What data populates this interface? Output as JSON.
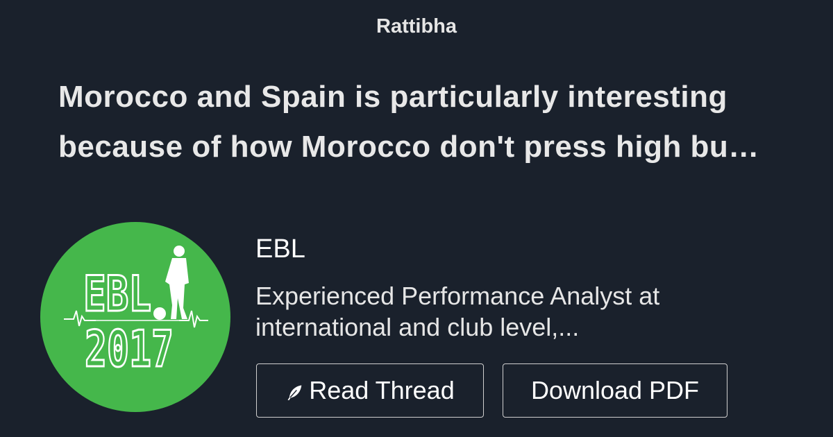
{
  "brand": "Rattibha",
  "headline": {
    "line1": "Morocco and Spain is particularly interesting",
    "line2": "because of how Morocco don't press high bu…"
  },
  "author": {
    "name": "EBL",
    "bio_line1": "Experienced Performance Analyst at",
    "bio_line2": "international and club level,...",
    "avatar_text_top": "EBL",
    "avatar_text_bottom": "2017"
  },
  "buttons": {
    "read_thread": "Read Thread",
    "download_pdf": "Download PDF"
  },
  "colors": {
    "background": "#1a212c",
    "avatar_green": "#45b74b"
  },
  "icons": {
    "read_thread_icon": "feather-icon"
  }
}
